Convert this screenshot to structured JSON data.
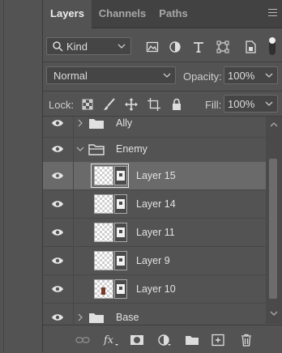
{
  "tabs": [
    {
      "label": "Layers",
      "active": true
    },
    {
      "label": "Channels",
      "active": false
    },
    {
      "label": "Paths",
      "active": false
    }
  ],
  "filter": {
    "kind_value": "Kind",
    "icons": [
      "image-filter-icon",
      "adjustment-filter-icon",
      "type-filter-icon",
      "shape-filter-icon",
      "smart-object-filter-icon"
    ]
  },
  "blend": {
    "mode": "Normal",
    "opacity_label": "Opacity:",
    "opacity_value": "100%"
  },
  "lock": {
    "label": "Lock:",
    "fill_label": "Fill:",
    "fill_value": "100%"
  },
  "layers": [
    {
      "name": "Ally",
      "type": "group",
      "expanded": false,
      "visible": true
    },
    {
      "name": "Enemy",
      "type": "group",
      "expanded": true,
      "visible": true
    },
    {
      "name": "Layer 15",
      "type": "layer",
      "selected": true,
      "visible": true
    },
    {
      "name": "Layer 14",
      "type": "layer",
      "visible": true
    },
    {
      "name": "Layer 11",
      "type": "layer",
      "visible": true
    },
    {
      "name": "Layer 9",
      "type": "layer",
      "visible": true
    },
    {
      "name": "Layer 10",
      "type": "layer",
      "visible": true
    },
    {
      "name": "Base",
      "type": "group",
      "expanded": false,
      "visible": true
    }
  ],
  "bottom_icons": [
    "link-layers-icon",
    "fx-icon",
    "add-mask-icon",
    "adjustment-layer-icon",
    "new-group-icon",
    "new-layer-icon",
    "delete-layer-icon"
  ],
  "colors": {
    "panel": "#535353",
    "tabbar": "#424242",
    "selected_row": "#6a6a6a"
  }
}
